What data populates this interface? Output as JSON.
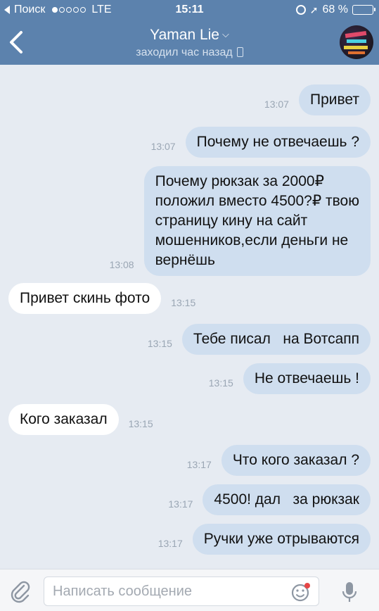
{
  "status_bar": {
    "back_app": "Поиск",
    "network": "LTE",
    "time": "15:11",
    "battery": "68 %",
    "battery_level": 0.68
  },
  "header": {
    "contact_name": "Yaman Lie",
    "contact_status": "заходил час назад"
  },
  "messages": [
    {
      "dir": "out",
      "text": "Привет",
      "time": "13:07"
    },
    {
      "dir": "out",
      "text": "Почему не отвечаешь ?",
      "time": "13:07"
    },
    {
      "dir": "out",
      "text": "Почему рюкзак за 2000₽\nположил вместо 4500?₽ твою\nстраницу кину на сайт\nмошенников,если деньги не\nвернёшь",
      "time": "13:08"
    },
    {
      "dir": "in",
      "text": "Привет скинь фото",
      "time": "13:15"
    },
    {
      "dir": "out",
      "text": "Тебе писал   на Вотсапп",
      "time": "13:15"
    },
    {
      "dir": "out",
      "text": "Не отвечаешь !",
      "time": "13:15"
    },
    {
      "dir": "in",
      "text": "Кого заказал",
      "time": "13:15"
    },
    {
      "dir": "out",
      "text": "Что кого заказал ?",
      "time": "13:17"
    },
    {
      "dir": "out",
      "text": "4500! дал   за рюкзак",
      "time": "13:17"
    },
    {
      "dir": "out",
      "text": "Ручки уже отрываются",
      "time": "13:17"
    }
  ],
  "composer": {
    "placeholder": "Написать сообщение"
  },
  "colors": {
    "header": "#5c82ad",
    "outgoing_bubble": "#cfdeef",
    "incoming_bubble": "#ffffff",
    "background": "#e6ebf2"
  }
}
